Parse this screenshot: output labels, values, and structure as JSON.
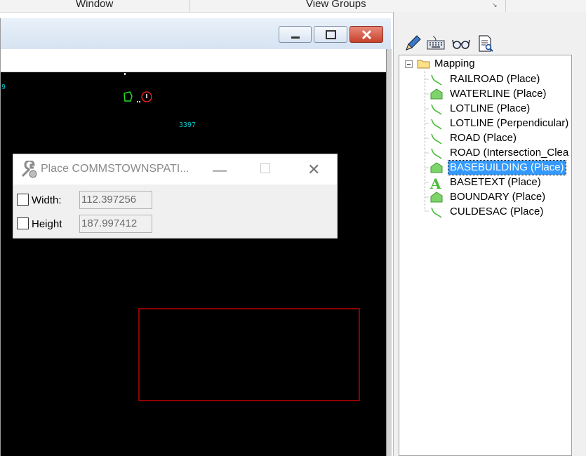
{
  "ribbon": {
    "tab_window": "Window",
    "tab_view_groups": "View Groups"
  },
  "dialog": {
    "title": "Place COMMSTOWNSPATI...",
    "width_label": "Width:",
    "width_value": "112.397256",
    "height_label": "Height",
    "height_value": "187.997412"
  },
  "canvas": {
    "text_3397": "3397",
    "text_9": "9"
  },
  "tree": {
    "root": "Mapping",
    "items": [
      {
        "label": "RAILROAD (Place)",
        "icon": "line-icon"
      },
      {
        "label": "WATERLINE (Place)",
        "icon": "polygon-icon"
      },
      {
        "label": "LOTLINE (Place)",
        "icon": "line-icon"
      },
      {
        "label": "LOTLINE (Perpendicular)",
        "icon": "line-icon"
      },
      {
        "label": "ROAD (Place)",
        "icon": "line-icon"
      },
      {
        "label": "ROAD (Intersection_Clea",
        "icon": "line-icon"
      },
      {
        "label": "BASEBUILDING (Place)",
        "icon": "polygon-icon",
        "selected": true
      },
      {
        "label": "BASETEXT (Place)",
        "icon": "text-icon"
      },
      {
        "label": "BOUNDARY (Place)",
        "icon": "polygon-icon"
      },
      {
        "label": "CULDESAC (Place)",
        "icon": "line-icon"
      }
    ]
  },
  "colors": {
    "canvas": "#000000",
    "selection": "#3399ff",
    "icon_green": "#7fd36b",
    "cad_red": "#c00000"
  }
}
